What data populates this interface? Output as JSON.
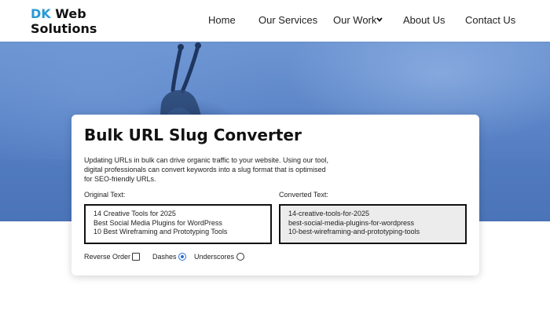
{
  "header": {
    "logo_prefix": "DK",
    "logo_rest_line1": " Web",
    "logo_line2": "Solutions",
    "brand_color": "#2a9ad6",
    "nav": [
      {
        "label": "Home"
      },
      {
        "label": "Our Services"
      },
      {
        "label": "Our Work",
        "has_dropdown": true
      },
      {
        "label": "About Us"
      },
      {
        "label": "Contact Us"
      }
    ]
  },
  "tool": {
    "title": "Bulk URL Slug Converter",
    "description": "Updating URLs in bulk can drive organic traffic to your website. Using our tool, digital professionals can convert keywords into a slug format that is optimised for SEO-friendly URLs.",
    "original_label": "Original Text:",
    "converted_label": "Converted Text:",
    "original_text": "14 Creative Tools for 2025\nBest Social Media Plugins for WordPress\n10 Best Wireframing and Prototyping Tools",
    "converted_text": "14-creative-tools-for-2025\nbest-social-media-plugins-for-wordpress\n10-best-wireframing-and-prototyping-tools",
    "options": {
      "reverse_order_label": "Reverse Order",
      "reverse_order_checked": false,
      "dashes_label": "Dashes",
      "dashes_selected": true,
      "underscores_label": "Underscores",
      "underscores_selected": false
    }
  }
}
